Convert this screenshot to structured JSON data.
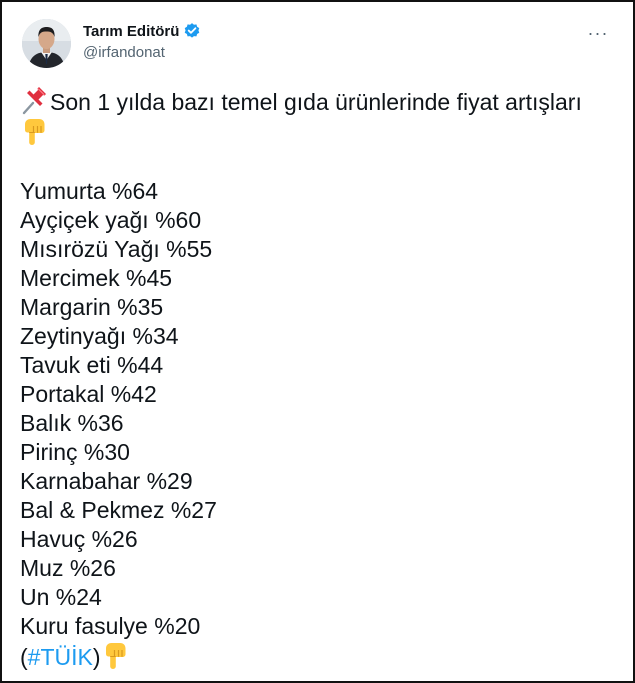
{
  "author": {
    "display_name": "Tarım Editörü",
    "handle": "@irfandonat",
    "verified_icon": "verified-badge-icon",
    "avatar": "avatar"
  },
  "menu": {
    "more_icon": "ellipsis-icon",
    "more_label": "···"
  },
  "tweet": {
    "headline_emoji": "pushpin-icon",
    "headline": "Son 1 yılda bazı temel gıda ürünlerinde fiyat artışları",
    "headline_end_emoji": "pointing-down-icon",
    "items": [
      "Yumurta %64",
      "Ayçiçek yağı %60",
      "Mısırözü Yağı %55",
      "Mercimek %45",
      "Margarin %35",
      "Zeytinyağı %34",
      "Tavuk eti %44",
      "Portakal %42",
      "Balık %36",
      "Pirinç %30",
      "Karnabahar %29",
      "Bal & Pekmez %27",
      "Havuç %26",
      "Muz %26",
      "Un %24",
      "Kuru fasulye %20"
    ],
    "source_open": "(",
    "source_hashtag": "#TÜİK",
    "source_close": ")",
    "source_emoji": "pointing-down-icon"
  },
  "colors": {
    "text": "#0f1419",
    "secondary": "#536471",
    "link": "#1d9bf0",
    "border": "#111111"
  }
}
